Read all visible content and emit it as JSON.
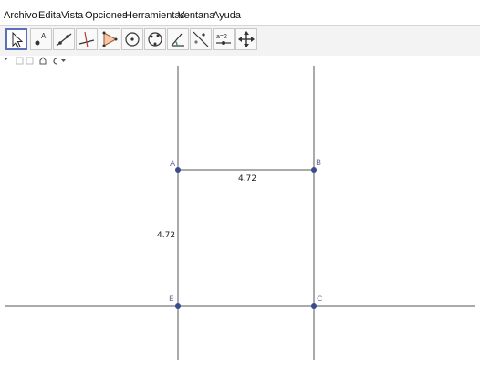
{
  "menu": [
    "Archivo",
    "Edita",
    "Vista",
    "Opciones",
    "Herramientas",
    "Ventana",
    "Ayuda"
  ],
  "toolbar": {
    "tools": [
      {
        "name": "move-tool",
        "active": true
      },
      {
        "name": "point-tool",
        "icon_text": "A"
      },
      {
        "name": "line-tool"
      },
      {
        "name": "perpendicular-tool"
      },
      {
        "name": "polygon-tool"
      },
      {
        "name": "circle-tool"
      },
      {
        "name": "circle-three-points-tool"
      },
      {
        "name": "angle-tool"
      },
      {
        "name": "reflect-tool"
      },
      {
        "name": "slider-tool",
        "icon_text": "a=2"
      },
      {
        "name": "move-view-tool"
      }
    ]
  },
  "graphics": {
    "points": [
      {
        "label": "A",
        "color": "#6a6f9c"
      },
      {
        "label": "B",
        "color": "#6a6f9c"
      },
      {
        "label": "C",
        "color": "#6a6f9c"
      },
      {
        "label": "E",
        "color": "#6a6f9c"
      }
    ],
    "segment_labels": {
      "ab": "4.72",
      "ae": "4.72"
    },
    "point_color": "#3a4a8c",
    "line_color": "#555555"
  }
}
